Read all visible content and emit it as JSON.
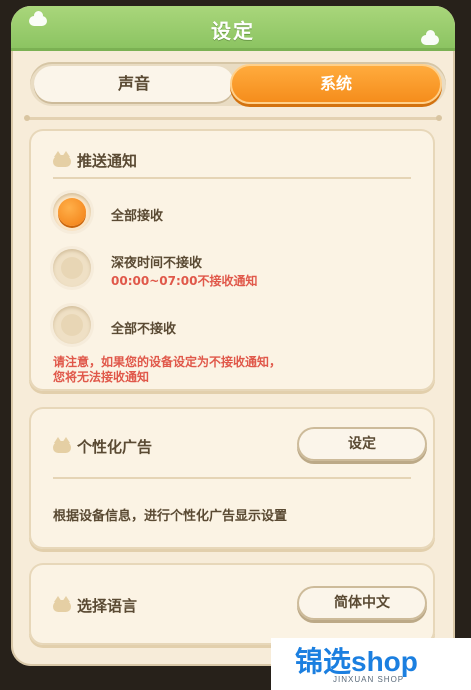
{
  "header": {
    "title": "设定"
  },
  "tabs": [
    {
      "label": "声音",
      "selected": false
    },
    {
      "label": "系统",
      "selected": true
    }
  ],
  "notifications": {
    "title": "推送通知",
    "options": [
      {
        "label": "全部接收",
        "selected": true
      },
      {
        "label": "深夜时间不接收",
        "sub": "00:00~07:00不接收通知",
        "selected": false
      },
      {
        "label": "全部不接收",
        "selected": false
      }
    ],
    "warning_line1": "请注意，如果您的设备设定为不接收通知，",
    "warning_line2": "您将无法接收通知"
  },
  "ads": {
    "title": "个性化广告",
    "button_label": "设定",
    "description": "根据设备信息，进行个性化广告显示设置"
  },
  "language": {
    "title": "选择语言",
    "current_value": "简体中文"
  },
  "watermark": {
    "main": "锦选shop",
    "sub": "JINXUAN SHOP"
  },
  "colors": {
    "accent": "#f58d1c",
    "header": "#8cc462",
    "warning": "#e0584a",
    "text": "#5a4a33"
  }
}
